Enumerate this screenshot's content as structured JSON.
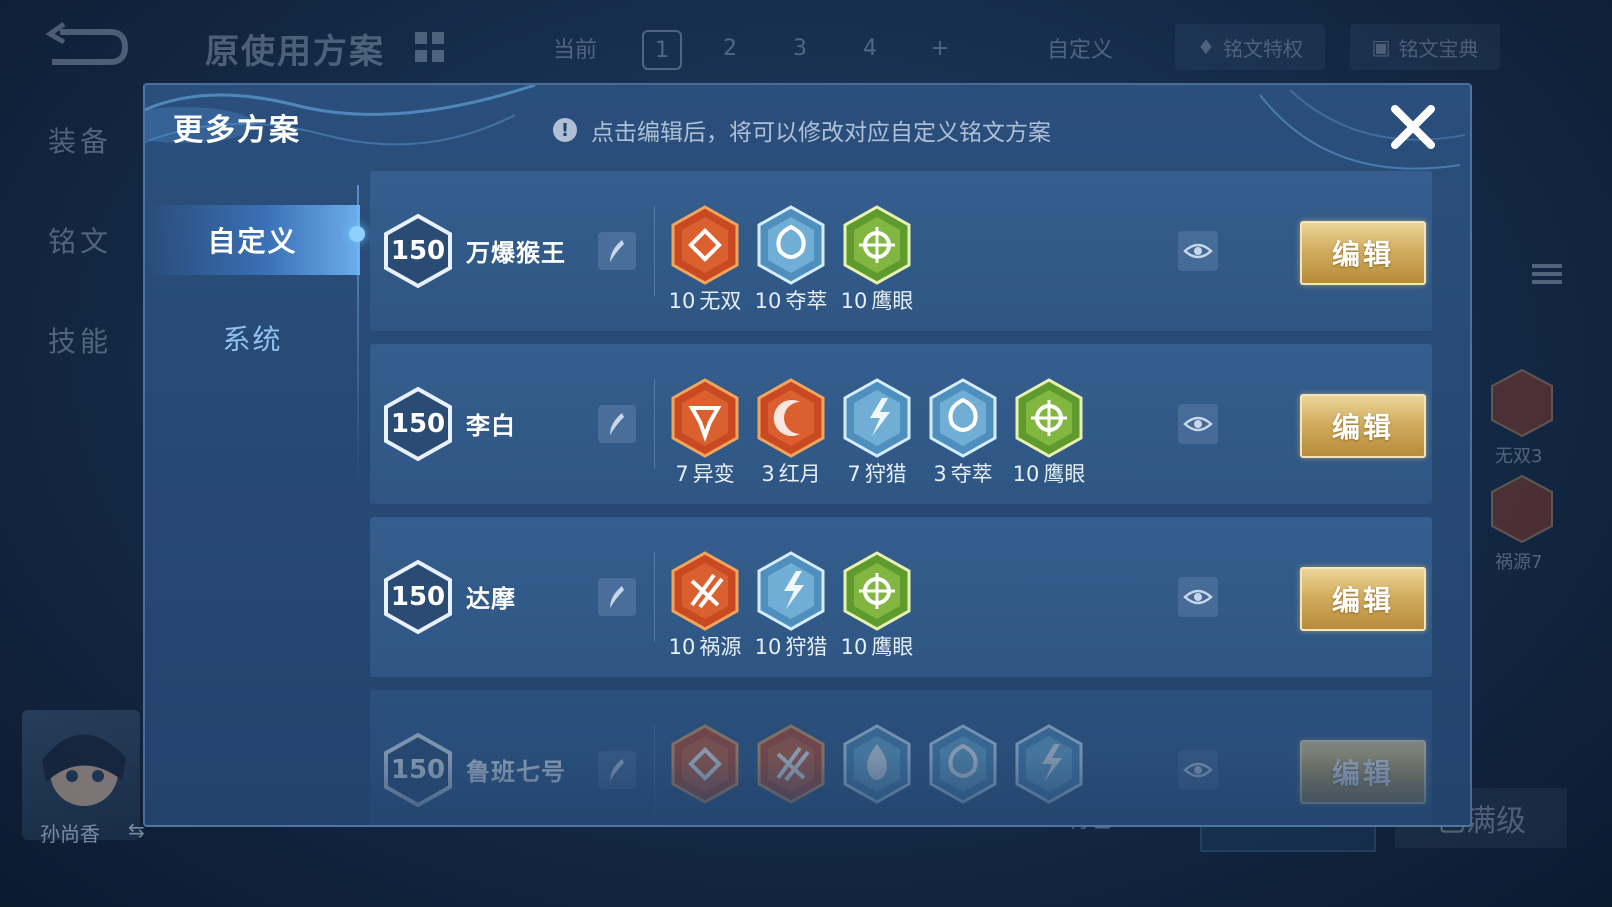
{
  "background": {
    "title": "原使用方案",
    "tabs": {
      "current": "当前",
      "slots": [
        "1",
        "2",
        "3",
        "4"
      ],
      "add": "+",
      "custom": "自定义"
    },
    "privilege": "铭文特权",
    "codex": "铭文宝典",
    "side_menu": [
      "装备",
      "铭文",
      "技能"
    ],
    "hero_name": "孙尚香",
    "bottom": {
      "bag": "背包",
      "max_level": "已满级"
    },
    "side_runes": [
      "无双3",
      "祸源7"
    ]
  },
  "modal": {
    "title": "更多方案",
    "info": "点击编辑后，将可以修改对应自定义铭文方案",
    "nav": {
      "custom": "自定义",
      "system": "系统"
    },
    "edit_label": "编辑",
    "plans": [
      {
        "level": "150",
        "name": "万爆猴王",
        "runes": [
          {
            "count": "10",
            "name": "无双",
            "icon": "wushuang-rune",
            "color": "red"
          },
          {
            "count": "10",
            "name": "夺萃",
            "icon": "duocui-rune",
            "color": "blue"
          },
          {
            "count": "10",
            "name": "鹰眼",
            "icon": "yingyan-rune",
            "color": "green"
          }
        ]
      },
      {
        "level": "150",
        "name": "李白",
        "runes": [
          {
            "count": "7",
            "name": "异变",
            "icon": "yibian-rune",
            "color": "red"
          },
          {
            "count": "3",
            "name": "红月",
            "icon": "hongyue-rune",
            "color": "red"
          },
          {
            "count": "7",
            "name": "狩猎",
            "icon": "shoulie-rune",
            "color": "blue"
          },
          {
            "count": "3",
            "name": "夺萃",
            "icon": "duocui-rune",
            "color": "blue"
          },
          {
            "count": "10",
            "name": "鹰眼",
            "icon": "yingyan-rune",
            "color": "green"
          }
        ]
      },
      {
        "level": "150",
        "name": "达摩",
        "runes": [
          {
            "count": "10",
            "name": "祸源",
            "icon": "huoyuan-rune",
            "color": "red"
          },
          {
            "count": "10",
            "name": "狩猎",
            "icon": "shoulie-rune",
            "color": "blue"
          },
          {
            "count": "10",
            "name": "鹰眼",
            "icon": "yingyan-rune",
            "color": "green"
          }
        ]
      },
      {
        "level": "150",
        "name": "鲁班七号",
        "runes": [
          {
            "count": "",
            "name": "",
            "icon": "wushuang-rune",
            "color": "red"
          },
          {
            "count": "",
            "name": "",
            "icon": "huoyuan-rune",
            "color": "red"
          },
          {
            "count": "",
            "name": "",
            "icon": "flame-rune",
            "color": "blue"
          },
          {
            "count": "",
            "name": "",
            "icon": "duocui-rune",
            "color": "blue"
          },
          {
            "count": "",
            "name": "",
            "icon": "shoulie-rune",
            "color": "blue"
          }
        ]
      }
    ]
  },
  "colors": {
    "red": "#d9522a",
    "blue": "#5aa8d6",
    "green": "#6fae3a",
    "gold": "#d2ad5e"
  }
}
